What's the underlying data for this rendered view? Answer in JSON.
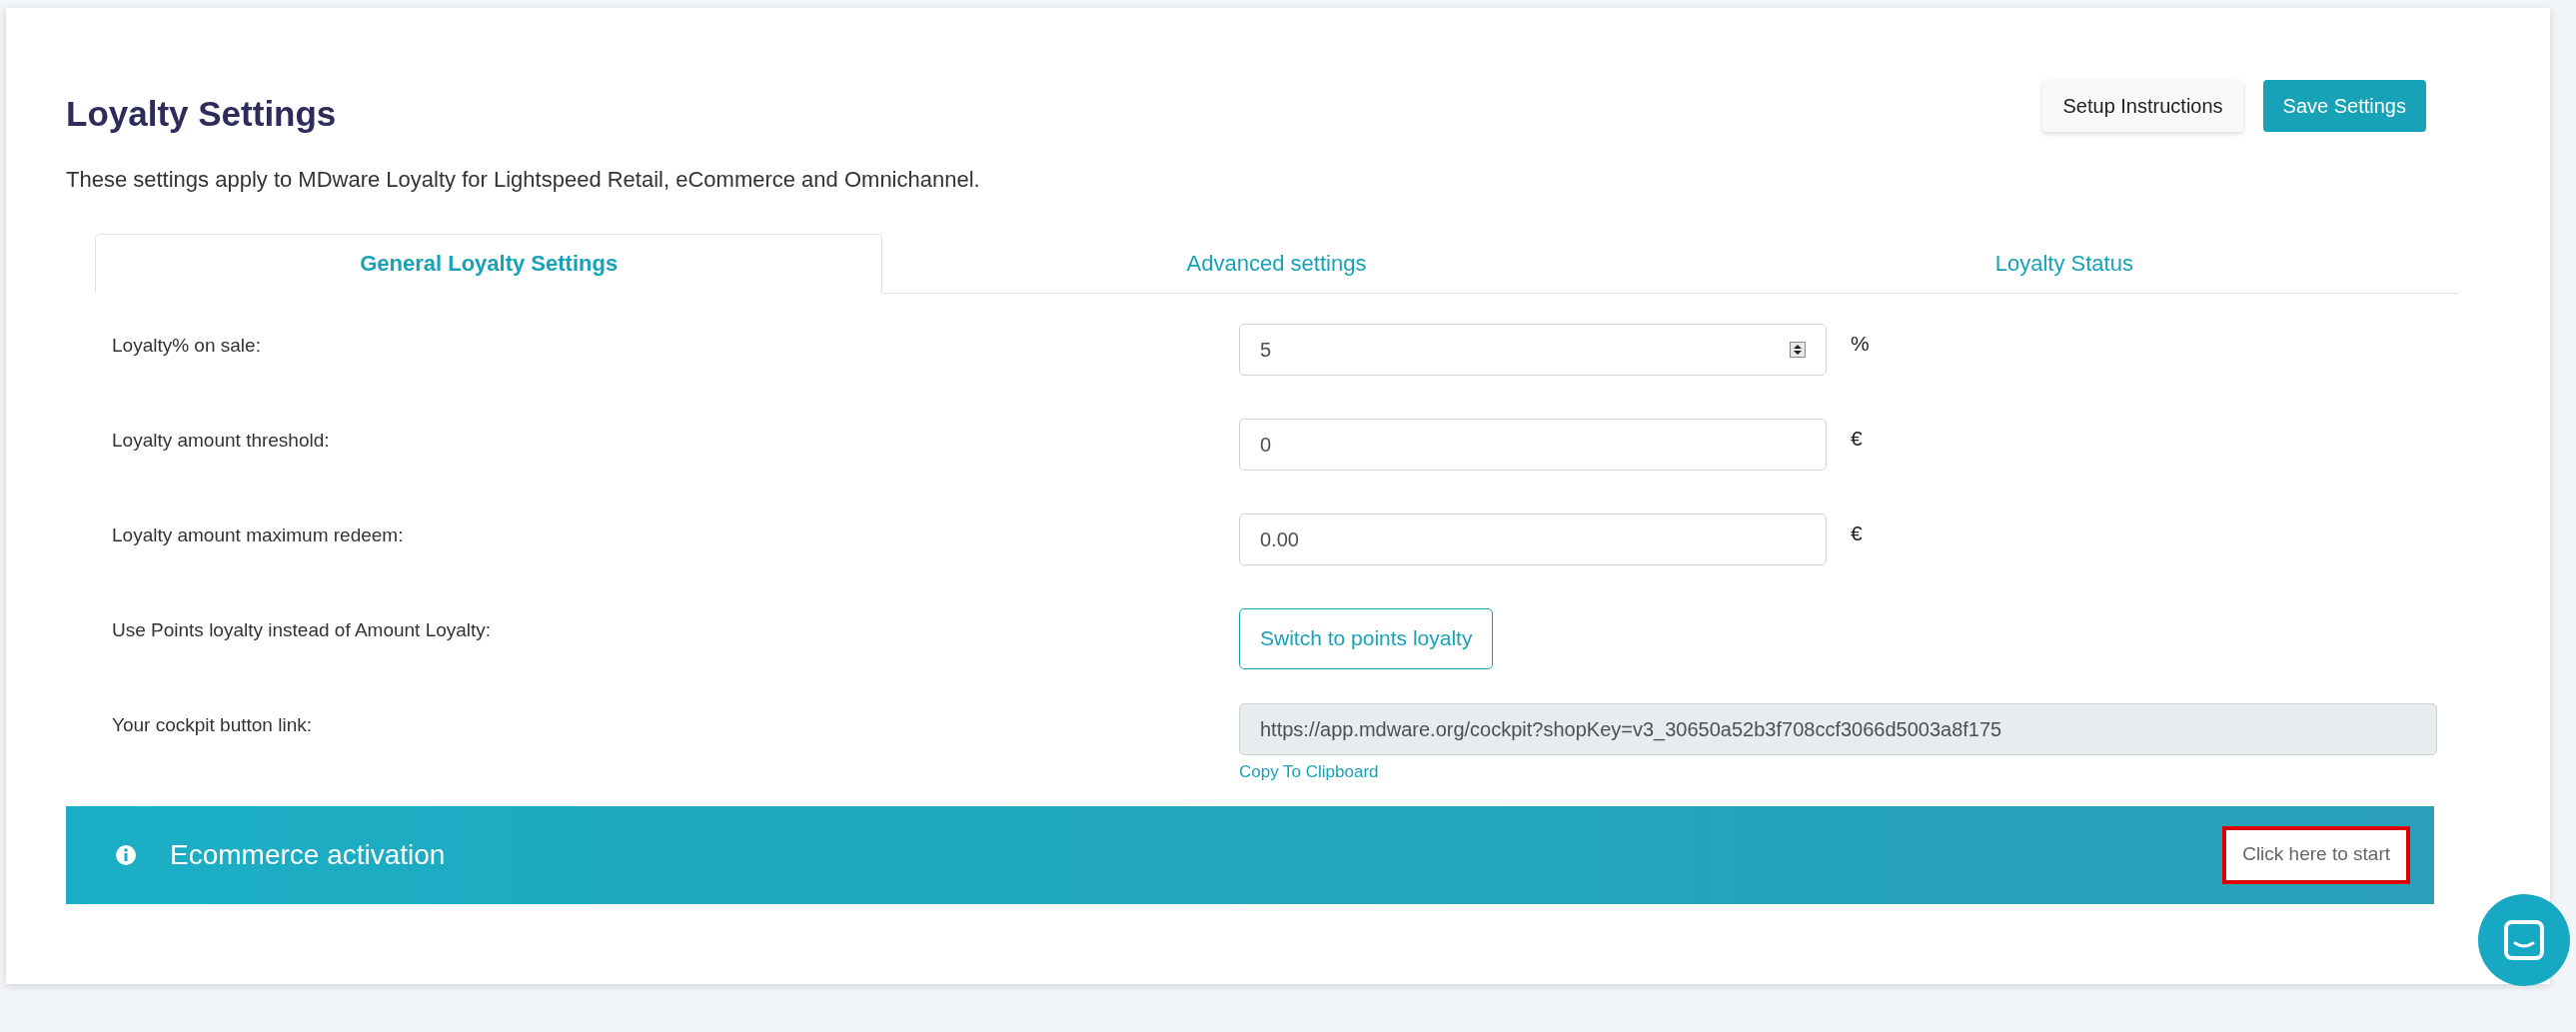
{
  "page": {
    "title": "Loyalty Settings",
    "subtitle": "These settings apply to MDware Loyalty for Lightspeed Retail, eCommerce and Omnichannel."
  },
  "header_buttons": [
    {
      "label": "Setup Instructions",
      "kind": "secondary"
    },
    {
      "label": "Save Settings",
      "kind": "primary"
    }
  ],
  "tabs": [
    {
      "label": "General Loyalty Settings",
      "selected": true
    },
    {
      "label": "Advanced settings",
      "selected": false
    },
    {
      "label": "Loyalty Status",
      "selected": false
    }
  ],
  "rows": [
    {
      "kind": "number",
      "label": "Loyalty% on sale:",
      "value": "5",
      "unit": "%"
    },
    {
      "kind": "text",
      "label": "Loyalty amount threshold:",
      "value": "0",
      "unit": "€"
    },
    {
      "kind": "text",
      "label": "Loyalty amount maximum redeem:",
      "value": "0.00",
      "unit": "€"
    },
    {
      "kind": "button",
      "label": "Use Points loyalty instead of Amount Loyalty:",
      "button": "Switch to points loyalty"
    },
    {
      "kind": "link",
      "label": "Your cockpit button link:",
      "value": "https://app.mdware.org/cockpit?shopKey=v3_30650a52b3f708ccf3066d5003a8f175",
      "link": "Copy To Clipboard"
    }
  ],
  "banner": {
    "title": "Ecommerce activation",
    "button": "Click here to start",
    "highlighted": true
  }
}
